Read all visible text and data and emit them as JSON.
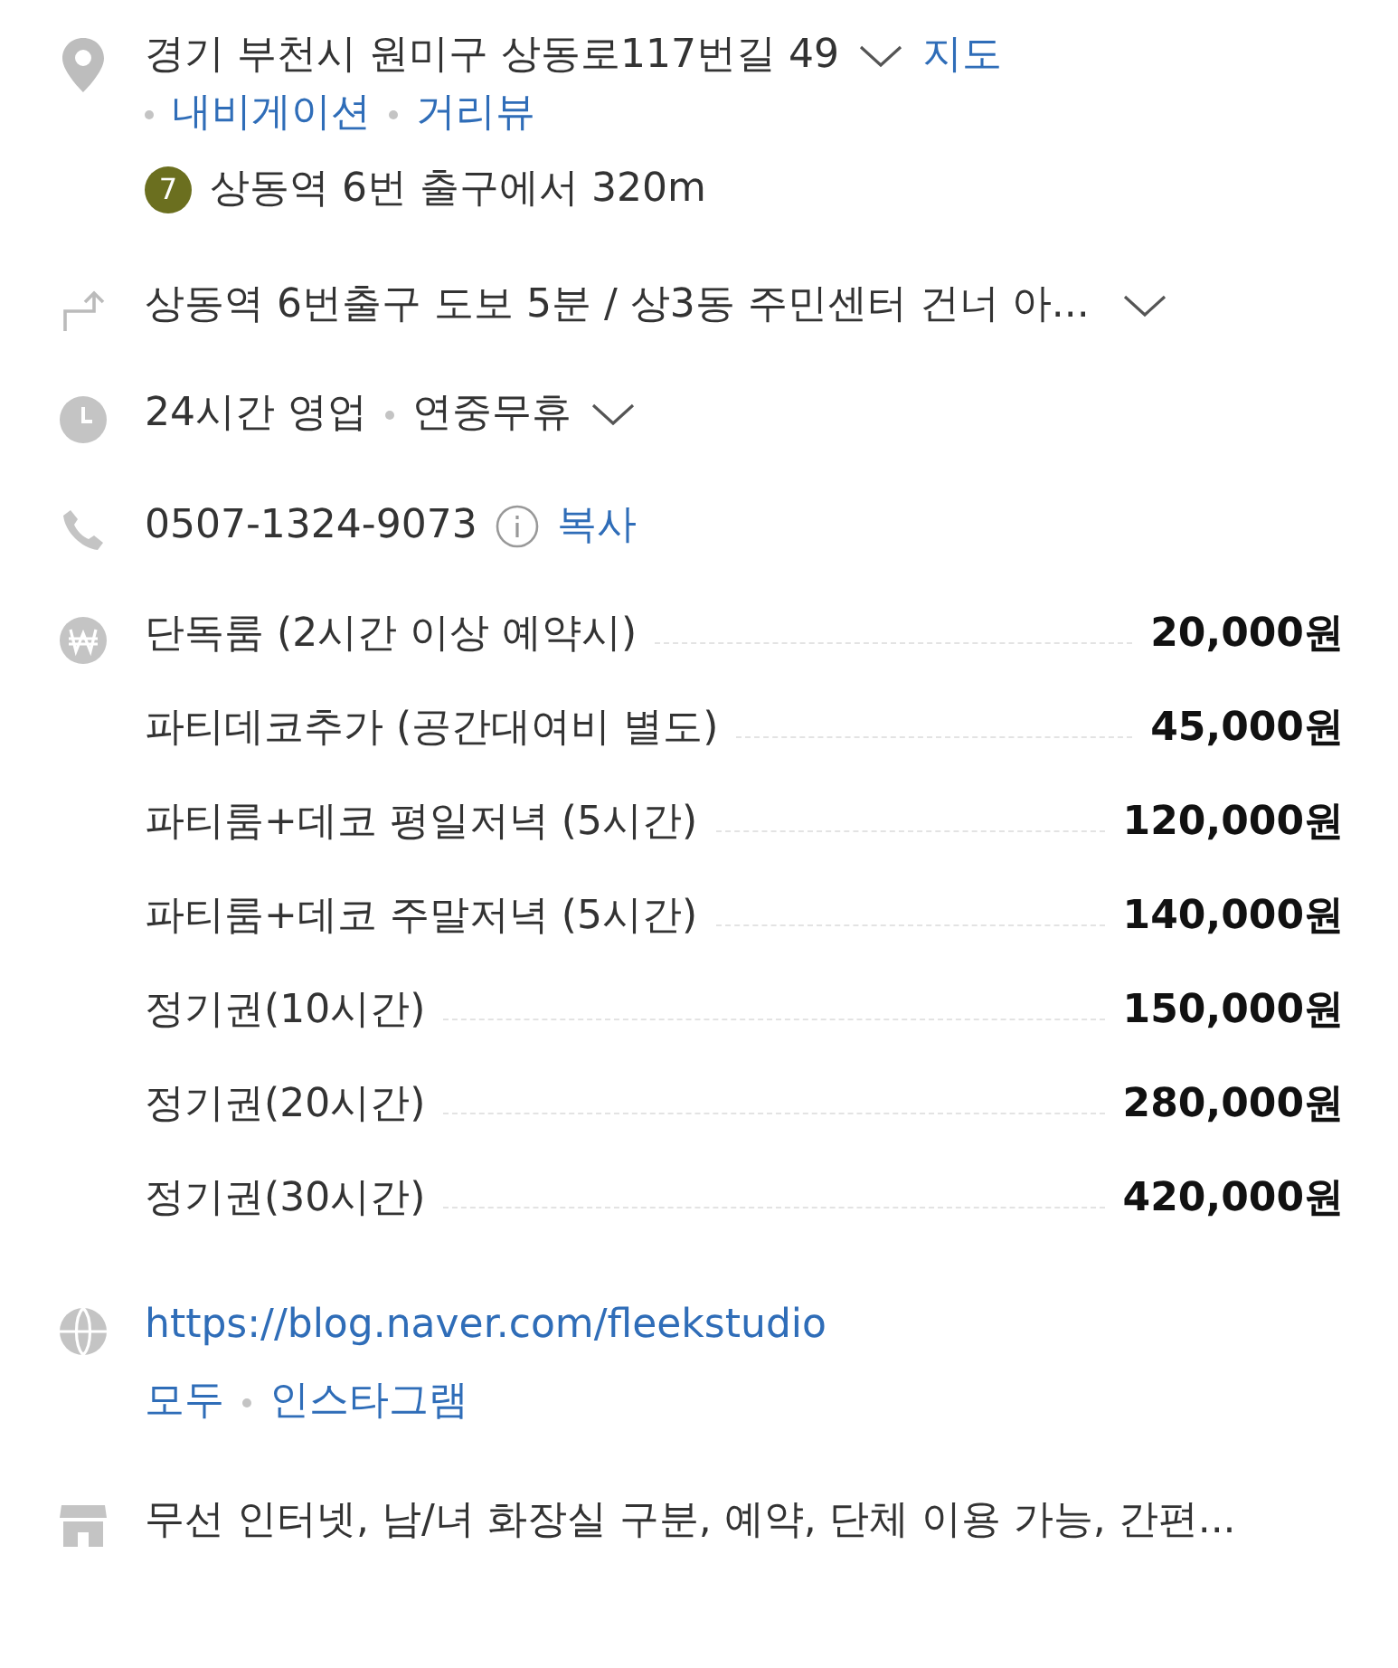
{
  "address": {
    "text": "경기 부천시 원미구 상동로117번길 49",
    "expanded": false,
    "map_link": "지도",
    "links": [
      "내비게이션",
      "거리뷰"
    ]
  },
  "subway": {
    "line": "7",
    "color": "#6b6f1f",
    "text": "상동역 6번 출구에서 320m"
  },
  "directions": {
    "text": "상동역 6번출구 도보 5분 / 상3동 주민센터 건너 아...",
    "expanded": false
  },
  "hours": {
    "status": "24시간 영업",
    "note": "연중무휴",
    "expanded": false
  },
  "phone": {
    "number": "0507-1324-9073",
    "copy": "복사"
  },
  "prices": [
    {
      "name": "단독룸 (2시간 이상 예약시)",
      "price": "20,000원"
    },
    {
      "name": "파티데코추가 (공간대여비 별도)",
      "price": "45,000원"
    },
    {
      "name": "파티룸+데코 평일저녁 (5시간)",
      "price": "120,000원"
    },
    {
      "name": "파티룸+데코 주말저녁 (5시간)",
      "price": "140,000원"
    },
    {
      "name": "정기권(10시간)",
      "price": "150,000원"
    },
    {
      "name": "정기권(20시간)",
      "price": "280,000원"
    },
    {
      "name": "정기권(30시간)",
      "price": "420,000원"
    }
  ],
  "website": {
    "url": "https://blog.naver.com/fleekstudio",
    "links": [
      "모두",
      "인스타그램"
    ]
  },
  "amenities": "무선 인터넷, 남/녀 화장실 구분, 예약, 단체 이용 가능, 간편..."
}
